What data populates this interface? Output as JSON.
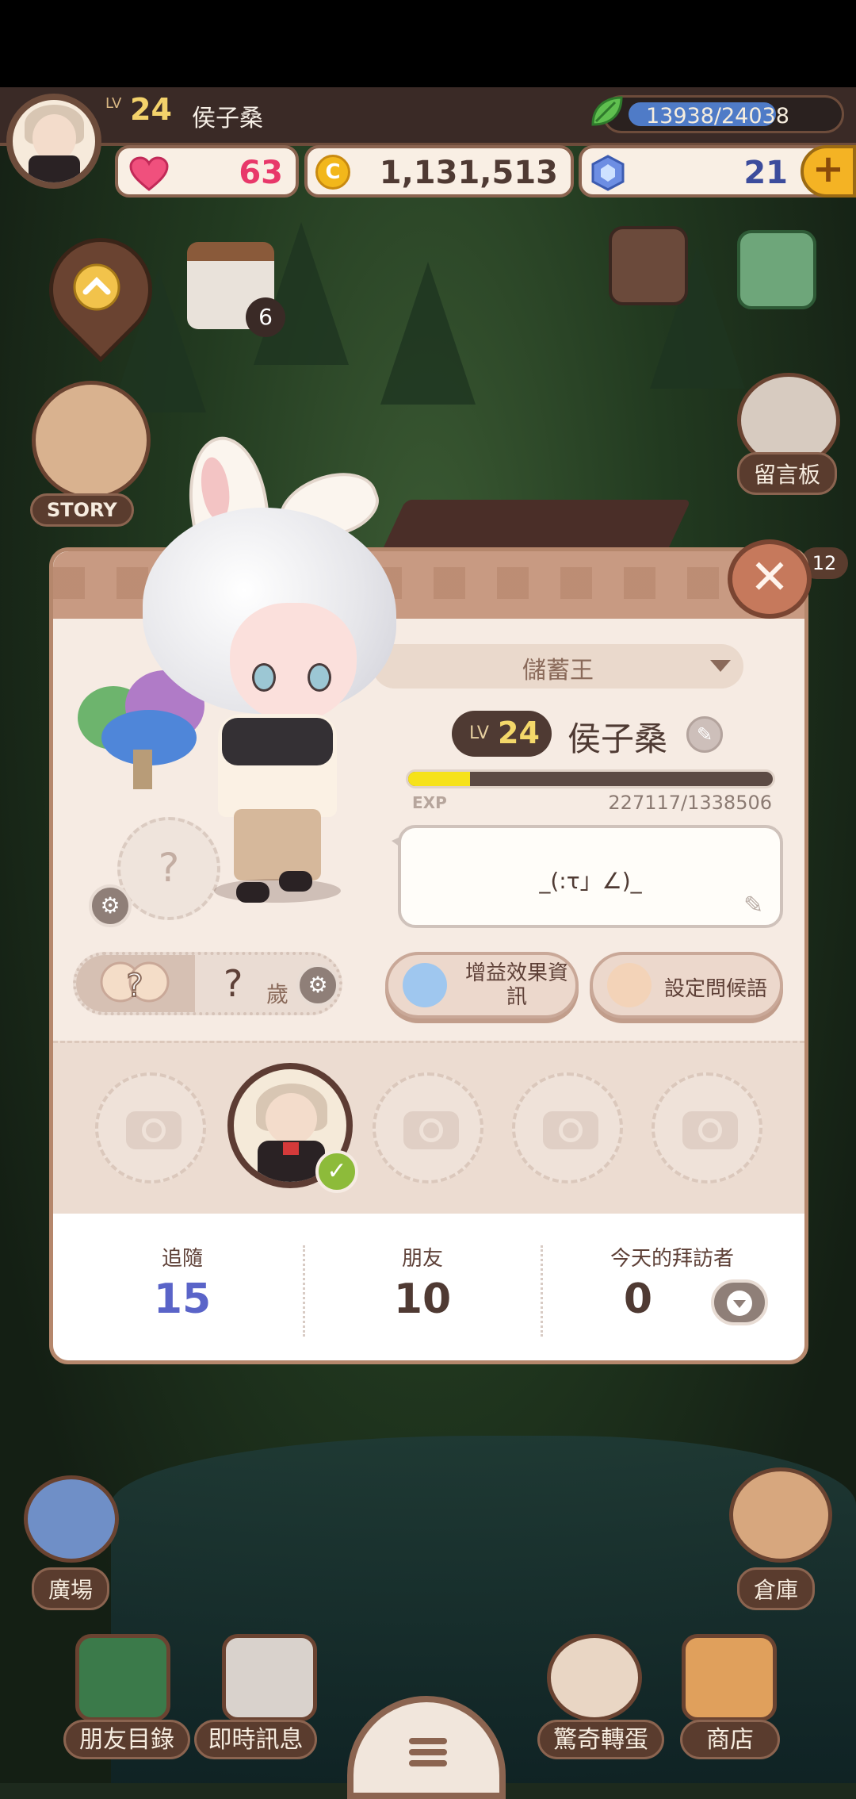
{
  "hud": {
    "level_prefix": "LV",
    "level": "24",
    "player_name": "侯子桑",
    "exp_text": "13938/24038",
    "hearts": "63",
    "coins": "1,131,513",
    "gems": "21",
    "plus_label": "+"
  },
  "map": {
    "story_label": "STORY",
    "calendar_badge": "6",
    "guestbook_label": "留言板",
    "side_badge": "12",
    "plaza_label": "廣場",
    "storage_label": "倉庫"
  },
  "profile": {
    "title": "儲蓄王",
    "level_prefix": "LV",
    "level": "24",
    "name": "侯子桑",
    "exp_tag": "EXP",
    "exp_count": "227117/1338506",
    "exp_progress_pct": 17,
    "greeting": "_(:τ」∠)_",
    "age_value": "?",
    "age_unit": "歲",
    "buff_button": "增益效果資訊",
    "buff_button_line1": "增益效果資",
    "buff_button_line2": "訊",
    "greeting_button": "設定問候語",
    "star_slot": "?",
    "stats": {
      "follow_label": "追隨",
      "follow_value": "15",
      "friends_label": "朋友",
      "friends_value": "10",
      "visitors_label": "今天的拜訪者",
      "visitors_value": "0"
    }
  },
  "bottom_nav": {
    "friends_list": "朋友目錄",
    "instant_message": "即時訊息",
    "surprise_gacha": "驚奇轉蛋",
    "shop": "商店"
  },
  "colors": {
    "accent_brown": "#6d4c3b",
    "follow_blue": "#5a64c8",
    "exp_yellow": "#f6e21a",
    "heart_pink": "#e8386a",
    "check_green": "#8dbb3a"
  }
}
